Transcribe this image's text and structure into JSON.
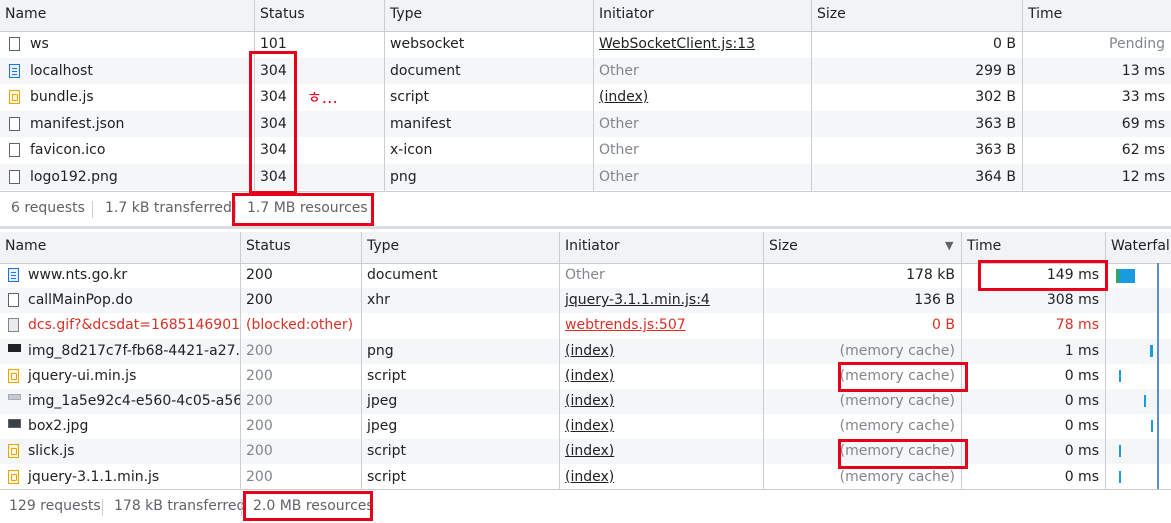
{
  "top_panel": {
    "columns": [
      "Name",
      "Status",
      "Type",
      "Initiator",
      "Size",
      "Time"
    ],
    "rows": [
      {
        "icon": "file-icon",
        "name": "ws",
        "status": "101",
        "type": "websocket",
        "initiator": "WebSocketClient.js:13",
        "initiator_link": true,
        "size": "0 B",
        "time": "Pending"
      },
      {
        "icon": "document-icon",
        "name": "localhost",
        "status": "304",
        "type": "document",
        "initiator": "Other",
        "initiator_link": false,
        "size": "299 B",
        "time": "13 ms"
      },
      {
        "icon": "script-icon",
        "name": "bundle.js",
        "status": "304",
        "type": "script",
        "initiator": "(index)",
        "initiator_link": true,
        "size": "302 B",
        "time": "33 ms"
      },
      {
        "icon": "file-icon",
        "name": "manifest.json",
        "status": "304",
        "type": "manifest",
        "initiator": "Other",
        "initiator_link": false,
        "size": "363 B",
        "time": "69 ms"
      },
      {
        "icon": "file-icon",
        "name": "favicon.ico",
        "status": "304",
        "type": "x-icon",
        "initiator": "Other",
        "initiator_link": false,
        "size": "363 B",
        "time": "62 ms"
      },
      {
        "icon": "file-icon",
        "name": "logo192.png",
        "status": "304",
        "type": "png",
        "initiator": "Other",
        "initiator_link": false,
        "size": "364 B",
        "time": "12 ms"
      }
    ],
    "annotation": "ㅎ…",
    "footer": {
      "requests": "6 requests",
      "transferred": "1.7 kB transferred",
      "resources": "1.7 MB resources"
    }
  },
  "bottom_panel": {
    "columns": [
      "Name",
      "Status",
      "Type",
      "Initiator",
      "Size",
      "Time",
      "Waterfall"
    ],
    "sort_indicator": "▼",
    "rows": [
      {
        "icon": "document-icon",
        "name": "www.nts.go.kr",
        "status": "200",
        "type": "document",
        "initiator": "Other",
        "initiator_link": false,
        "size": "178 kB",
        "time": "149 ms",
        "blocked": false
      },
      {
        "icon": "file-icon",
        "name": "callMainPop.do",
        "status": "200",
        "type": "xhr",
        "initiator": "jquery-3.1.1.min.js:4",
        "initiator_link": true,
        "size": "136 B",
        "time": "308 ms",
        "blocked": false
      },
      {
        "icon": "blocked-image-icon",
        "name": "dcs.gif?&dcsdat=1685146901...",
        "status": "(blocked:other)",
        "type": "",
        "initiator": "webtrends.js:507",
        "initiator_link": true,
        "size": "0 B",
        "time": "78 ms",
        "blocked": true
      },
      {
        "icon": "image-icon",
        "name": "img_8d217c7f-fb68-4421-a27...",
        "status": "200",
        "type": "png",
        "initiator": "(index)",
        "initiator_link": true,
        "size": "(memory cache)",
        "time": "1 ms",
        "blocked": false
      },
      {
        "icon": "script-icon",
        "name": "jquery-ui.min.js",
        "status": "200",
        "type": "script",
        "initiator": "(index)",
        "initiator_link": true,
        "size": "(memory cache)",
        "time": "0 ms",
        "blocked": false
      },
      {
        "icon": "image-icon",
        "name": "img_1a5e92c4-e560-4c05-a56...",
        "status": "200",
        "type": "jpeg",
        "initiator": "(index)",
        "initiator_link": true,
        "size": "(memory cache)",
        "time": "0 ms",
        "blocked": false
      },
      {
        "icon": "image-icon",
        "name": "box2.jpg",
        "status": "200",
        "type": "jpeg",
        "initiator": "(index)",
        "initiator_link": true,
        "size": "(memory cache)",
        "time": "0 ms",
        "blocked": false
      },
      {
        "icon": "script-icon",
        "name": "slick.js",
        "status": "200",
        "type": "script",
        "initiator": "(index)",
        "initiator_link": true,
        "size": "(memory cache)",
        "time": "0 ms",
        "blocked": false
      },
      {
        "icon": "script-icon",
        "name": "jquery-3.1.1.min.js",
        "status": "200",
        "type": "script",
        "initiator": "(index)",
        "initiator_link": true,
        "size": "(memory cache)",
        "time": "0 ms",
        "blocked": false
      }
    ],
    "footer": {
      "requests": "129 requests",
      "transferred": "178 kB transferred",
      "resources": "2.0 MB resources"
    }
  },
  "colors": {
    "highlight_box": "#e8001b",
    "error_text": "#d93025",
    "waterfall_bar": "#1a9be0"
  }
}
